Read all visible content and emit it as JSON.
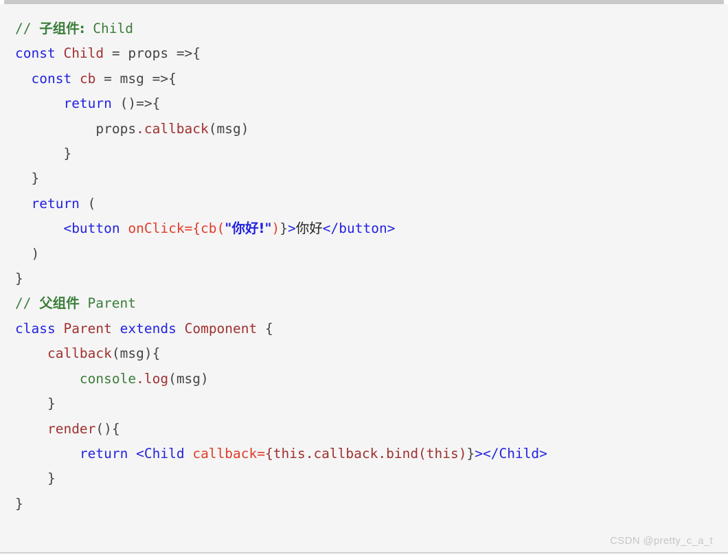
{
  "window": {
    "background_color": "#ffffff",
    "card_background_color": "#f5f5f5",
    "top_bar_color": "#c9c9c9"
  },
  "palette": {
    "comment_green": "#3a7d3a",
    "keyword_blue": "#2222e0",
    "identifier_dark_red": "#a03030",
    "jsx_attribute_red": "#e03c28",
    "string_blue": "#2222e0",
    "plain_gray": "#444444",
    "object_green": "#3a7d3a",
    "jsx_text_black": "#222222",
    "watermark_gray": "#c6c6c6"
  },
  "code": {
    "language": "jsx",
    "lines": [
      {
        "indent": 0,
        "tokens": [
          {
            "text": "// ",
            "kind": "comment"
          },
          {
            "text": "子组件:",
            "kind": "comment-cjk"
          },
          {
            "text": " Child",
            "kind": "comment"
          }
        ]
      },
      {
        "indent": 0,
        "tokens": [
          {
            "text": "const",
            "kind": "keyword"
          },
          {
            "text": " ",
            "kind": "plain"
          },
          {
            "text": "Child",
            "kind": "ident"
          },
          {
            "text": " = props =>{",
            "kind": "plain"
          }
        ]
      },
      {
        "indent": 2,
        "tokens": [
          {
            "text": "const",
            "kind": "keyword"
          },
          {
            "text": " ",
            "kind": "plain"
          },
          {
            "text": "cb",
            "kind": "ident"
          },
          {
            "text": " = msg =>{",
            "kind": "plain"
          }
        ]
      },
      {
        "indent": 6,
        "tokens": [
          {
            "text": "return",
            "kind": "keyword"
          },
          {
            "text": " ()=>{",
            "kind": "plain"
          }
        ]
      },
      {
        "indent": 10,
        "tokens": [
          {
            "text": "props",
            "kind": "plain"
          },
          {
            "text": ".callback",
            "kind": "fn"
          },
          {
            "text": "(msg)",
            "kind": "plain"
          }
        ]
      },
      {
        "indent": 6,
        "tokens": [
          {
            "text": "}",
            "kind": "plain"
          }
        ]
      },
      {
        "indent": 2,
        "tokens": [
          {
            "text": "}",
            "kind": "plain"
          }
        ]
      },
      {
        "indent": 2,
        "tokens": [
          {
            "text": "return",
            "kind": "keyword"
          },
          {
            "text": " (",
            "kind": "plain"
          }
        ]
      },
      {
        "indent": 6,
        "tokens": [
          {
            "text": "<button",
            "kind": "tag"
          },
          {
            "text": " ",
            "kind": "plain"
          },
          {
            "text": "onClick={cb(",
            "kind": "attr"
          },
          {
            "text": "\"你好!\"",
            "kind": "string-cjk"
          },
          {
            "text": ")",
            "kind": "attr"
          },
          {
            "text": "}",
            "kind": "plain"
          },
          {
            "text": ">",
            "kind": "tag"
          },
          {
            "text": "你好",
            "kind": "text-cjk"
          },
          {
            "text": "</button>",
            "kind": "tag"
          }
        ]
      },
      {
        "indent": 2,
        "tokens": [
          {
            "text": ")",
            "kind": "plain"
          }
        ]
      },
      {
        "indent": 0,
        "tokens": [
          {
            "text": "}",
            "kind": "plain"
          }
        ]
      },
      {
        "indent": 0,
        "tokens": [
          {
            "text": "// ",
            "kind": "comment"
          },
          {
            "text": "父组件",
            "kind": "comment-cjk"
          },
          {
            "text": " Parent",
            "kind": "comment"
          }
        ]
      },
      {
        "indent": 0,
        "tokens": [
          {
            "text": "class",
            "kind": "keyword"
          },
          {
            "text": " ",
            "kind": "plain"
          },
          {
            "text": "Parent",
            "kind": "ident"
          },
          {
            "text": " ",
            "kind": "plain"
          },
          {
            "text": "extends",
            "kind": "keyword"
          },
          {
            "text": " ",
            "kind": "plain"
          },
          {
            "text": "Component",
            "kind": "ident"
          },
          {
            "text": " {",
            "kind": "plain"
          }
        ]
      },
      {
        "indent": 4,
        "tokens": [
          {
            "text": "callback",
            "kind": "fn"
          },
          {
            "text": "(msg){",
            "kind": "plain"
          }
        ]
      },
      {
        "indent": 8,
        "tokens": [
          {
            "text": "console",
            "kind": "obj"
          },
          {
            "text": ".log",
            "kind": "fn"
          },
          {
            "text": "(msg)",
            "kind": "plain"
          }
        ]
      },
      {
        "indent": 4,
        "tokens": [
          {
            "text": "}",
            "kind": "plain"
          }
        ]
      },
      {
        "indent": 4,
        "tokens": [
          {
            "text": "render",
            "kind": "fn"
          },
          {
            "text": "(){",
            "kind": "plain"
          }
        ]
      },
      {
        "indent": 8,
        "tokens": [
          {
            "text": "return",
            "kind": "keyword"
          },
          {
            "text": " ",
            "kind": "plain"
          },
          {
            "text": "<Child",
            "kind": "tag"
          },
          {
            "text": " ",
            "kind": "plain"
          },
          {
            "text": "callback=",
            "kind": "attr"
          },
          {
            "text": "{this.callback.bind(this)",
            "kind": "fn"
          },
          {
            "text": "}",
            "kind": "plain"
          },
          {
            "text": "></Child>",
            "kind": "tag"
          }
        ]
      },
      {
        "indent": 4,
        "tokens": [
          {
            "text": "}",
            "kind": "plain"
          }
        ]
      },
      {
        "indent": 0,
        "tokens": [
          {
            "text": "}",
            "kind": "plain"
          }
        ]
      }
    ]
  },
  "watermark": {
    "text": "CSDN @pretty_c_a_t"
  }
}
